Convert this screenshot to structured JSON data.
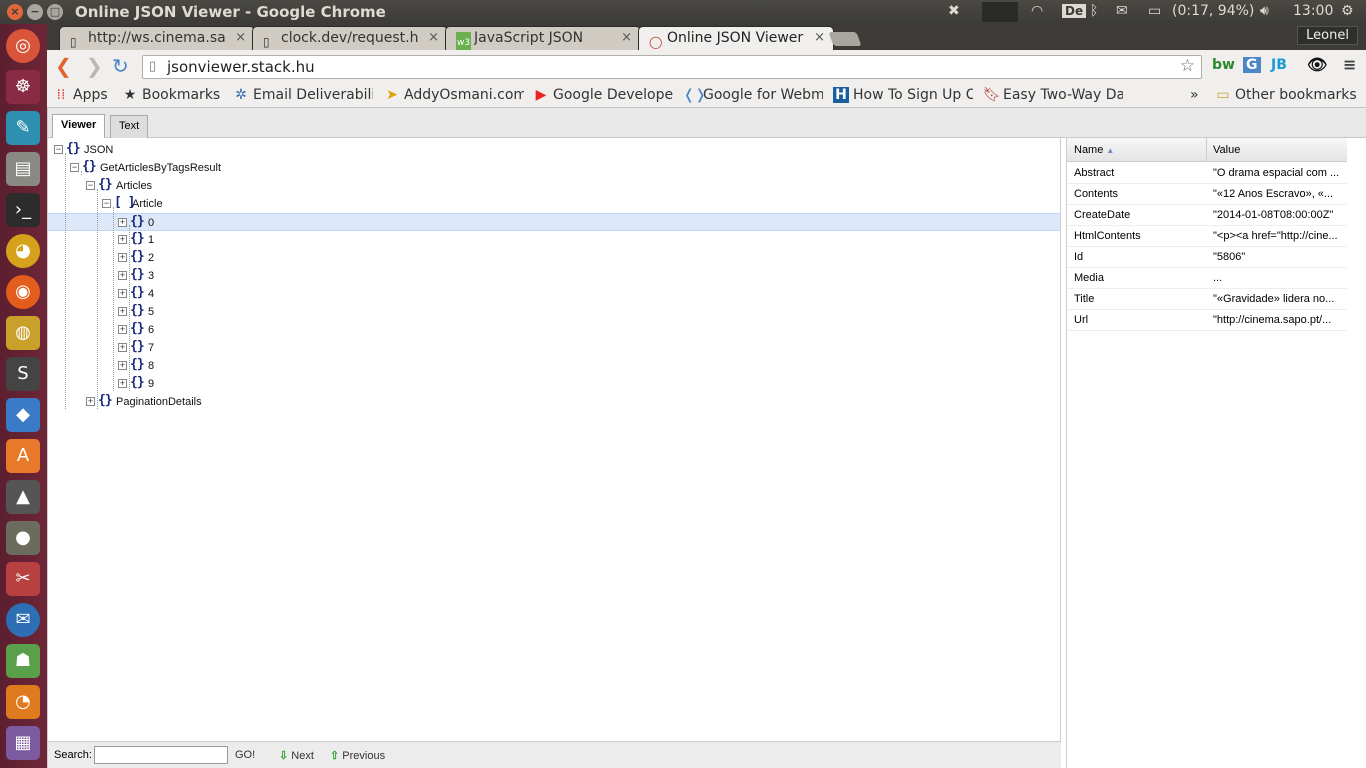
{
  "system": {
    "window_title": "Online JSON Viewer - Google Chrome",
    "keyboard_layout": "De",
    "battery": "(0:17, 94%)",
    "clock": "13:00",
    "user": "Leonel"
  },
  "tabs": [
    {
      "label": "http://ws.cinema.sa",
      "icon": "page-icon"
    },
    {
      "label": "clock.dev/request.h",
      "icon": "page-icon"
    },
    {
      "label": "JavaScript JSON",
      "icon": "w3-icon"
    },
    {
      "label": "Online JSON Viewer",
      "icon": "jsonviewer-icon",
      "active": true
    }
  ],
  "omnibox": {
    "url": "jsonviewer.stack.hu"
  },
  "bookmarks": [
    {
      "label": "Apps",
      "icon": "apps-grid-icon"
    },
    {
      "label": "Bookmarks",
      "icon": "star-icon"
    },
    {
      "label": "Email Deliverabili",
      "icon": "gear-icon"
    },
    {
      "label": "AddyOsmani.com",
      "icon": "arrow-icon"
    },
    {
      "label": "Google Develope",
      "icon": "youtube-icon"
    },
    {
      "label": "Google for Webm",
      "icon": "webmaster-icon"
    },
    {
      "label": "How To Sign Up C",
      "icon": "h-icon"
    },
    {
      "label": "Easy Two-Way Da",
      "icon": "bookmark-icon"
    }
  ],
  "bookmarks_overflow": "»",
  "other_bookmarks": "Other bookmarks",
  "viewer": {
    "tab_viewer": "Viewer",
    "tab_text": "Text"
  },
  "tree": [
    {
      "label": "JSON",
      "type": "object",
      "level": 0,
      "toggle": "−"
    },
    {
      "label": "GetArticlesByTagsResult",
      "type": "object",
      "level": 1,
      "toggle": "−"
    },
    {
      "label": "Articles",
      "type": "object",
      "level": 2,
      "toggle": "−"
    },
    {
      "label": "Article",
      "type": "array",
      "level": 3,
      "toggle": "−"
    },
    {
      "label": "0",
      "type": "object",
      "level": 4,
      "toggle": "+",
      "selected": true
    },
    {
      "label": "1",
      "type": "object",
      "level": 4,
      "toggle": "+"
    },
    {
      "label": "2",
      "type": "object",
      "level": 4,
      "toggle": "+"
    },
    {
      "label": "3",
      "type": "object",
      "level": 4,
      "toggle": "+"
    },
    {
      "label": "4",
      "type": "object",
      "level": 4,
      "toggle": "+"
    },
    {
      "label": "5",
      "type": "object",
      "level": 4,
      "toggle": "+"
    },
    {
      "label": "6",
      "type": "object",
      "level": 4,
      "toggle": "+"
    },
    {
      "label": "7",
      "type": "object",
      "level": 4,
      "toggle": "+"
    },
    {
      "label": "8",
      "type": "object",
      "level": 4,
      "toggle": "+"
    },
    {
      "label": "9",
      "type": "object",
      "level": 4,
      "toggle": "+"
    },
    {
      "label": "PaginationDetails",
      "type": "object",
      "level": 2,
      "toggle": "+"
    }
  ],
  "search": {
    "label": "Search:",
    "go": "GO!",
    "next": "Next",
    "previous": "Previous"
  },
  "properties": {
    "col_name": "Name",
    "col_value": "Value",
    "rows": [
      {
        "name": "Abstract",
        "value": "\"O drama espacial com ..."
      },
      {
        "name": "Contents",
        "value": "\"«12 Anos Escravo», «..."
      },
      {
        "name": "CreateDate",
        "value": "\"2014-01-08T08:00:00Z\""
      },
      {
        "name": "HtmlContents",
        "value": "\"<p><a href=\"http://cine..."
      },
      {
        "name": "Id",
        "value": "\"5806\""
      },
      {
        "name": "Media",
        "value": "..."
      },
      {
        "name": "Title",
        "value": "\"«Gravidade» lidera no..."
      },
      {
        "name": "Url",
        "value": "\"http://cinema.sapo.pt/..."
      }
    ]
  }
}
